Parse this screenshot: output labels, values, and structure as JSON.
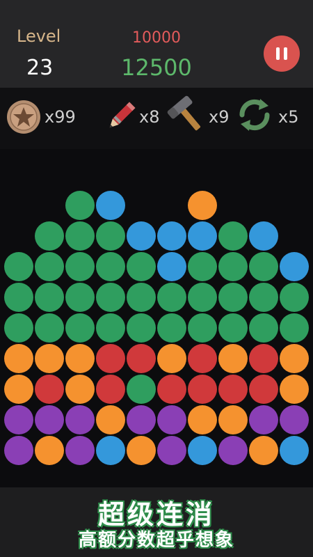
{
  "header": {
    "level_label": "Level",
    "level_value": "23",
    "target_score": "10000",
    "current_score": "12500"
  },
  "tools": {
    "star_count": "x99",
    "pencil_count": "x8",
    "hammer_count": "x9",
    "refresh_count": "x5"
  },
  "board": {
    "colors": {
      "G": "#2f9e5f",
      "B": "#3498db",
      "O": "#f5922f",
      "R": "#d0393b",
      "P": "#8a3fb5"
    },
    "rows": [
      "..GB..O...",
      ".GGGBBBGB.",
      "GGGGGBGGGB",
      "GGGGGGGGGG",
      "GGGGGGGGGG",
      "OOORRORORO",
      "ORORGRRRRO",
      "PPPOPPOOPP",
      "POPBOPBPOB"
    ]
  },
  "promo": {
    "title": "超级连消",
    "subtitle": "高额分数超乎想象"
  }
}
